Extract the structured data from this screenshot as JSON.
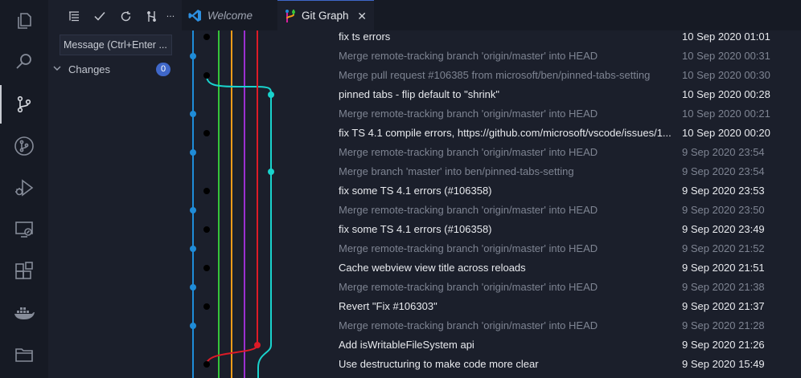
{
  "activity_bar": {
    "items": [
      {
        "name": "explorer-icon"
      },
      {
        "name": "search-icon"
      },
      {
        "name": "source-control-icon"
      },
      {
        "name": "git-graph-icon"
      },
      {
        "name": "run-debug-icon"
      },
      {
        "name": "remote-explorer-icon"
      },
      {
        "name": "extensions-icon"
      },
      {
        "name": "docker-icon"
      },
      {
        "name": "folder-icon"
      }
    ]
  },
  "sidebar": {
    "toolbar_more": "···",
    "message_placeholder": "Message (Ctrl+Enter ...",
    "changes_label": "Changes",
    "changes_count": "0"
  },
  "tabs": [
    {
      "label": "Welcome"
    },
    {
      "label": "Git Graph",
      "close": "✕"
    }
  ],
  "colors": {
    "blue": "#1f8cd8",
    "magenta": "#d61f9c",
    "green": "#36c43a",
    "orange": "#f09b19",
    "purple": "#9b2fd0",
    "red": "#dc1b27",
    "cyan": "#19d3cd",
    "accent": "#3f67c9"
  },
  "commits": [
    {
      "message": "fix ts errors",
      "date": "10 Sep 2020 01:01",
      "merge": false
    },
    {
      "message": "Merge remote-tracking branch 'origin/master' into HEAD",
      "date": "10 Sep 2020 00:31",
      "merge": true
    },
    {
      "message": "Merge pull request #106385 from microsoft/ben/pinned-tabs-setting",
      "date": "10 Sep 2020 00:30",
      "merge": true
    },
    {
      "message": "pinned tabs - flip default to \"shrink\"",
      "date": "10 Sep 2020 00:28",
      "merge": false
    },
    {
      "message": "Merge remote-tracking branch 'origin/master' into HEAD",
      "date": "10 Sep 2020 00:21",
      "merge": true
    },
    {
      "message": "fix TS 4.1 compile errors, https://github.com/microsoft/vscode/issues/1...",
      "date": "10 Sep 2020 00:20",
      "merge": false
    },
    {
      "message": "Merge remote-tracking branch 'origin/master' into HEAD",
      "date": "9 Sep 2020 23:54",
      "merge": true
    },
    {
      "message": "Merge branch 'master' into ben/pinned-tabs-setting",
      "date": "9 Sep 2020 23:54",
      "merge": true
    },
    {
      "message": "fix some TS 4.1 errors (#106358)",
      "date": "9 Sep 2020 23:53",
      "merge": false
    },
    {
      "message": "Merge remote-tracking branch 'origin/master' into HEAD",
      "date": "9 Sep 2020 23:50",
      "merge": true
    },
    {
      "message": "fix some TS 4.1 errors (#106358)",
      "date": "9 Sep 2020 23:49",
      "merge": false
    },
    {
      "message": "Merge remote-tracking branch 'origin/master' into HEAD",
      "date": "9 Sep 2020 21:52",
      "merge": true
    },
    {
      "message": "Cache webview view title across reloads",
      "date": "9 Sep 2020 21:51",
      "merge": false
    },
    {
      "message": "Merge remote-tracking branch 'origin/master' into HEAD",
      "date": "9 Sep 2020 21:38",
      "merge": true
    },
    {
      "message": "Revert \"Fix #106303\"",
      "date": "9 Sep 2020 21:37",
      "merge": false
    },
    {
      "message": "Merge remote-tracking branch 'origin/master' into HEAD",
      "date": "9 Sep 2020 21:28",
      "merge": true
    },
    {
      "message": "Add isWritableFileSystem api",
      "date": "9 Sep 2020 21:26",
      "merge": false
    },
    {
      "message": "Use destructuring to make code more clear",
      "date": "9 Sep 2020 15:49",
      "merge": false
    }
  ]
}
